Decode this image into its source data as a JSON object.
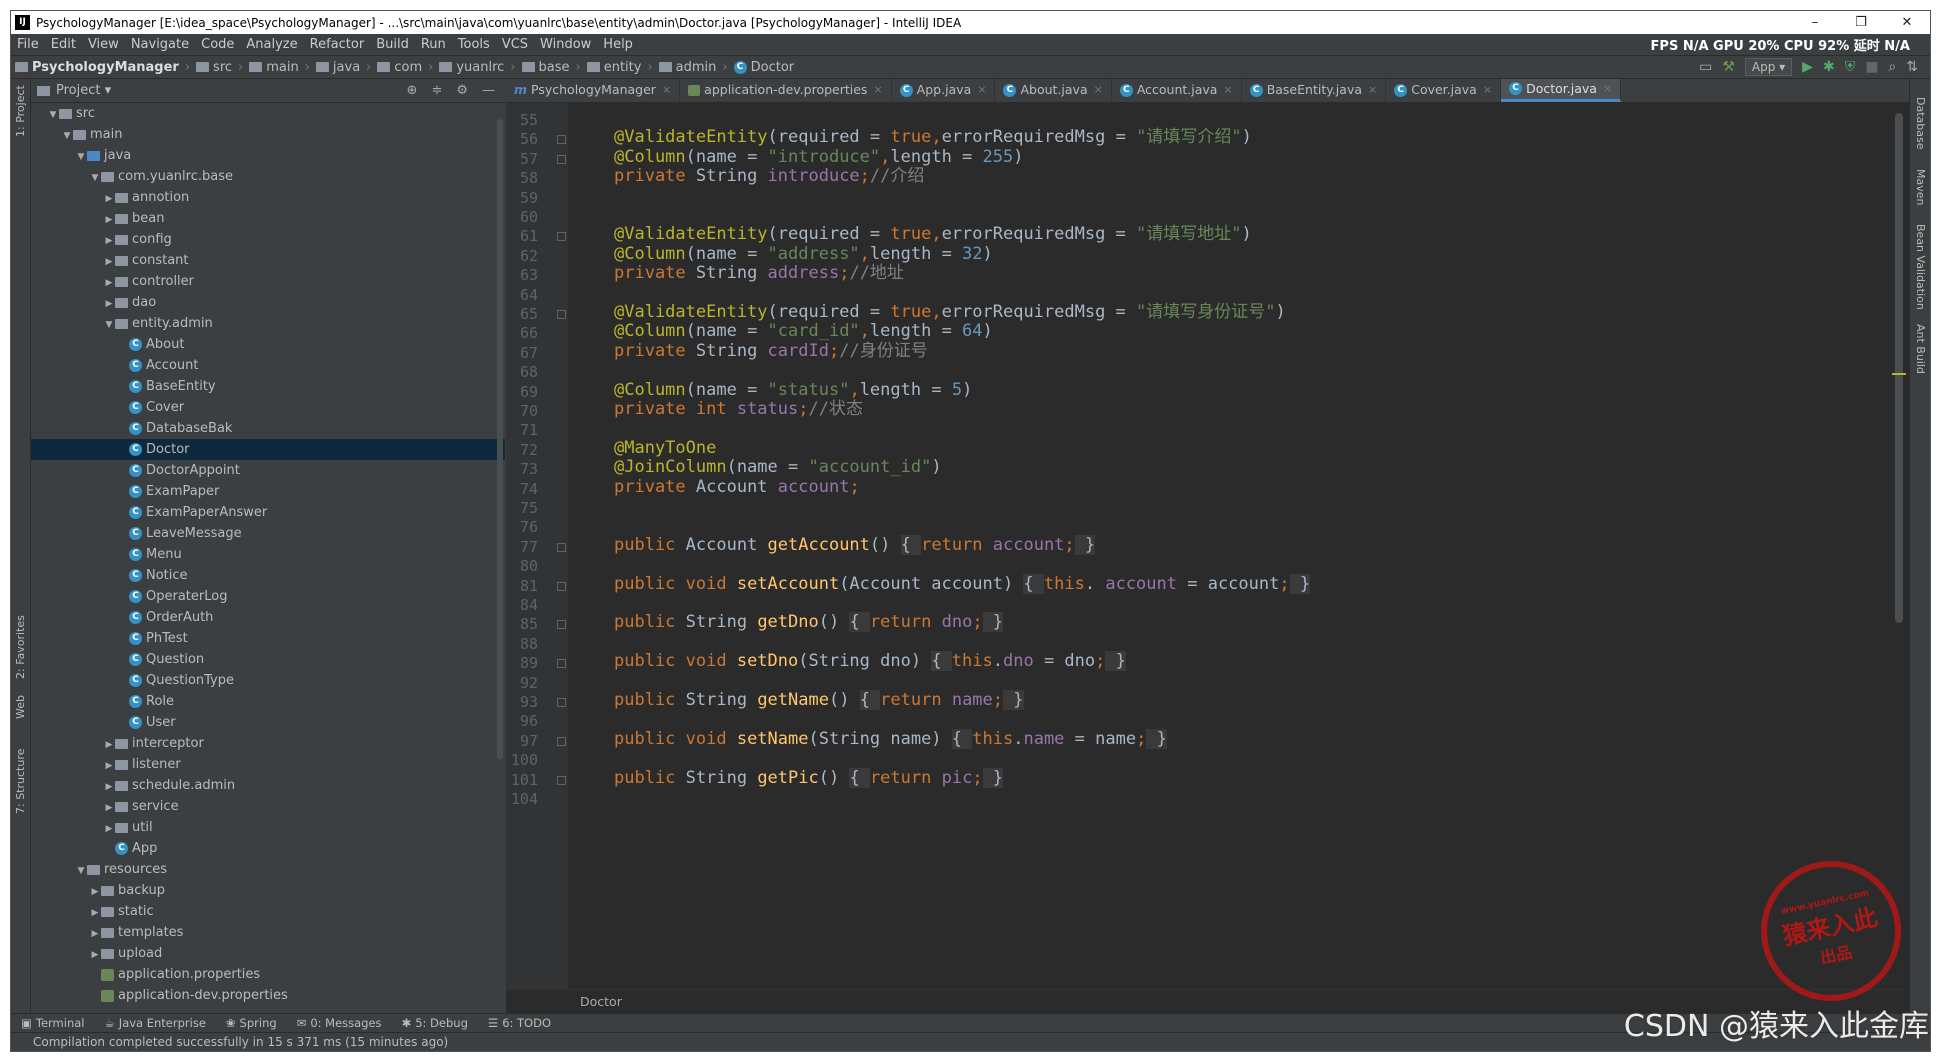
{
  "window": {
    "title": "PsychologyManager [E:\\idea_space\\PsychologyManager] - ...\\src\\main\\java\\com\\yuanlrc\\base\\entity\\admin\\Doctor.java [PsychologyManager] - IntelliJ IDEA",
    "minimize": "–",
    "maximize": "❐",
    "close": "✕"
  },
  "menu": {
    "items": [
      "File",
      "Edit",
      "View",
      "Navigate",
      "Code",
      "Analyze",
      "Refactor",
      "Build",
      "Run",
      "Tools",
      "VCS",
      "Window",
      "Help"
    ],
    "perf": "FPS N/A GPU 20% CPU 92% 延时 N/A"
  },
  "nav": {
    "crumbs": [
      "PsychologyManager",
      "src",
      "main",
      "java",
      "com",
      "yuanlrc",
      "base",
      "entity",
      "admin",
      "Doctor"
    ],
    "run_config": "App ▾"
  },
  "sidebars": {
    "left": [
      "1: Project",
      "2: Favorites",
      "Web",
      "7: Structure"
    ],
    "right": [
      "Database",
      "Maven",
      "Bean Validation",
      "Ant Build"
    ]
  },
  "project": {
    "header": "Project ▾",
    "tree": [
      {
        "label": "src",
        "depth": 1,
        "arrow": "▼",
        "icon": "folder"
      },
      {
        "label": "main",
        "depth": 2,
        "arrow": "▼",
        "icon": "folder"
      },
      {
        "label": "java",
        "depth": 3,
        "arrow": "▼",
        "icon": "src"
      },
      {
        "label": "com.yuanlrc.base",
        "depth": 4,
        "arrow": "▼",
        "icon": "pkg"
      },
      {
        "label": "annotion",
        "depth": 5,
        "arrow": "▶",
        "icon": "pkg"
      },
      {
        "label": "bean",
        "depth": 5,
        "arrow": "▶",
        "icon": "pkg"
      },
      {
        "label": "config",
        "depth": 5,
        "arrow": "▶",
        "icon": "pkg"
      },
      {
        "label": "constant",
        "depth": 5,
        "arrow": "▶",
        "icon": "pkg"
      },
      {
        "label": "controller",
        "depth": 5,
        "arrow": "▶",
        "icon": "pkg"
      },
      {
        "label": "dao",
        "depth": 5,
        "arrow": "▶",
        "icon": "pkg"
      },
      {
        "label": "entity.admin",
        "depth": 5,
        "arrow": "▼",
        "icon": "pkg"
      },
      {
        "label": "About",
        "depth": 6,
        "arrow": "",
        "icon": "class"
      },
      {
        "label": "Account",
        "depth": 6,
        "arrow": "",
        "icon": "class"
      },
      {
        "label": "BaseEntity",
        "depth": 6,
        "arrow": "",
        "icon": "class"
      },
      {
        "label": "Cover",
        "depth": 6,
        "arrow": "",
        "icon": "class"
      },
      {
        "label": "DatabaseBak",
        "depth": 6,
        "arrow": "",
        "icon": "class"
      },
      {
        "label": "Doctor",
        "depth": 6,
        "arrow": "",
        "icon": "class",
        "selected": true
      },
      {
        "label": "DoctorAppoint",
        "depth": 6,
        "arrow": "",
        "icon": "class"
      },
      {
        "label": "ExamPaper",
        "depth": 6,
        "arrow": "",
        "icon": "class"
      },
      {
        "label": "ExamPaperAnswer",
        "depth": 6,
        "arrow": "",
        "icon": "class"
      },
      {
        "label": "LeaveMessage",
        "depth": 6,
        "arrow": "",
        "icon": "class"
      },
      {
        "label": "Menu",
        "depth": 6,
        "arrow": "",
        "icon": "class"
      },
      {
        "label": "Notice",
        "depth": 6,
        "arrow": "",
        "icon": "class"
      },
      {
        "label": "OperaterLog",
        "depth": 6,
        "arrow": "",
        "icon": "class"
      },
      {
        "label": "OrderAuth",
        "depth": 6,
        "arrow": "",
        "icon": "class"
      },
      {
        "label": "PhTest",
        "depth": 6,
        "arrow": "",
        "icon": "class"
      },
      {
        "label": "Question",
        "depth": 6,
        "arrow": "",
        "icon": "class"
      },
      {
        "label": "QuestionType",
        "depth": 6,
        "arrow": "",
        "icon": "class"
      },
      {
        "label": "Role",
        "depth": 6,
        "arrow": "",
        "icon": "class"
      },
      {
        "label": "User",
        "depth": 6,
        "arrow": "",
        "icon": "class"
      },
      {
        "label": "interceptor",
        "depth": 5,
        "arrow": "▶",
        "icon": "pkg"
      },
      {
        "label": "listener",
        "depth": 5,
        "arrow": "▶",
        "icon": "pkg"
      },
      {
        "label": "schedule.admin",
        "depth": 5,
        "arrow": "▶",
        "icon": "pkg"
      },
      {
        "label": "service",
        "depth": 5,
        "arrow": "▶",
        "icon": "pkg"
      },
      {
        "label": "util",
        "depth": 5,
        "arrow": "▶",
        "icon": "pkg"
      },
      {
        "label": "App",
        "depth": 5,
        "arrow": "",
        "icon": "class"
      },
      {
        "label": "resources",
        "depth": 3,
        "arrow": "▼",
        "icon": "folder"
      },
      {
        "label": "backup",
        "depth": 4,
        "arrow": "▶",
        "icon": "folder"
      },
      {
        "label": "static",
        "depth": 4,
        "arrow": "▶",
        "icon": "folder"
      },
      {
        "label": "templates",
        "depth": 4,
        "arrow": "▶",
        "icon": "folder"
      },
      {
        "label": "upload",
        "depth": 4,
        "arrow": "▶",
        "icon": "folder"
      },
      {
        "label": "application.properties",
        "depth": 4,
        "arrow": "",
        "icon": "props"
      },
      {
        "label": "application-dev.properties",
        "depth": 4,
        "arrow": "",
        "icon": "props"
      }
    ]
  },
  "tabs": [
    {
      "label": "PsychologyManager",
      "active": false
    },
    {
      "label": "application-dev.properties",
      "active": false
    },
    {
      "label": "App.java",
      "active": false
    },
    {
      "label": "About.java",
      "active": false
    },
    {
      "label": "Account.java",
      "active": false
    },
    {
      "label": "BaseEntity.java",
      "active": false
    },
    {
      "label": "Cover.java",
      "active": false
    },
    {
      "label": "Doctor.java",
      "active": true
    }
  ],
  "editor": {
    "lines": [
      {
        "n": "55",
        "fold": false,
        "tokens": []
      },
      {
        "n": "56",
        "fold": true,
        "tokens": [
          [
            "an",
            "@ValidateEntity"
          ],
          [
            "",
            "("
          ],
          [
            "",
            "required"
          ],
          [
            "",
            " = "
          ],
          [
            "kw",
            "true"
          ],
          [
            "kw",
            ","
          ],
          [
            "",
            "errorRequiredMsg"
          ],
          [
            "",
            " = "
          ],
          [
            "st",
            "\"请填写介绍\""
          ],
          [
            "",
            ")"
          ]
        ]
      },
      {
        "n": "57",
        "fold": true,
        "tokens": [
          [
            "an",
            "@Column"
          ],
          [
            "",
            "(name = "
          ],
          [
            "st",
            "\"introduce\""
          ],
          [
            "kw",
            ","
          ],
          [
            "",
            "length = "
          ],
          [
            "nm",
            "255"
          ],
          [
            "",
            ")"
          ]
        ]
      },
      {
        "n": "58",
        "fold": false,
        "tokens": [
          [
            "kw",
            "private "
          ],
          [
            "",
            "String "
          ],
          [
            "fd",
            "introduce"
          ],
          [
            "kw",
            ";"
          ],
          [
            "cm",
            "//介绍"
          ]
        ]
      },
      {
        "n": "59",
        "fold": false,
        "tokens": []
      },
      {
        "n": "60",
        "fold": false,
        "tokens": []
      },
      {
        "n": "61",
        "fold": true,
        "tokens": [
          [
            "an",
            "@ValidateEntity"
          ],
          [
            "",
            "(required = "
          ],
          [
            "kw",
            "true"
          ],
          [
            "kw",
            ","
          ],
          [
            "",
            "errorRequiredMsg = "
          ],
          [
            "st",
            "\"请填写地址\""
          ],
          [
            "",
            ")"
          ]
        ]
      },
      {
        "n": "62",
        "fold": false,
        "tokens": [
          [
            "an",
            "@Column"
          ],
          [
            "",
            "(name = "
          ],
          [
            "st",
            "\"address\""
          ],
          [
            "kw",
            ","
          ],
          [
            "",
            "length = "
          ],
          [
            "nm",
            "32"
          ],
          [
            "",
            ")"
          ]
        ]
      },
      {
        "n": "63",
        "fold": false,
        "tokens": [
          [
            "kw",
            "private "
          ],
          [
            "",
            "String "
          ],
          [
            "fd",
            "address"
          ],
          [
            "kw",
            ";"
          ],
          [
            "cm",
            "//地址"
          ]
        ]
      },
      {
        "n": "64",
        "fold": false,
        "tokens": []
      },
      {
        "n": "65",
        "fold": true,
        "tokens": [
          [
            "an",
            "@ValidateEntity"
          ],
          [
            "",
            "(required = "
          ],
          [
            "kw",
            "true"
          ],
          [
            "kw",
            ","
          ],
          [
            "",
            "errorRequiredMsg = "
          ],
          [
            "st",
            "\"请填写身份证号\""
          ],
          [
            "",
            ")"
          ]
        ]
      },
      {
        "n": "66",
        "fold": false,
        "tokens": [
          [
            "an",
            "@Column"
          ],
          [
            "",
            "(name = "
          ],
          [
            "st",
            "\"card_id\""
          ],
          [
            "kw",
            ","
          ],
          [
            "",
            "length = "
          ],
          [
            "nm",
            "64"
          ],
          [
            "",
            ")"
          ]
        ]
      },
      {
        "n": "67",
        "fold": false,
        "tokens": [
          [
            "kw",
            "private "
          ],
          [
            "",
            "String "
          ],
          [
            "fd",
            "cardId"
          ],
          [
            "kw",
            ";"
          ],
          [
            "cm",
            "//身份证号"
          ]
        ]
      },
      {
        "n": "68",
        "fold": false,
        "tokens": []
      },
      {
        "n": "69",
        "fold": false,
        "tokens": [
          [
            "an",
            "@Column"
          ],
          [
            "",
            "(name = "
          ],
          [
            "st",
            "\"status\""
          ],
          [
            "kw",
            ","
          ],
          [
            "",
            "length = "
          ],
          [
            "nm",
            "5"
          ],
          [
            "",
            ")"
          ]
        ]
      },
      {
        "n": "70",
        "fold": false,
        "tokens": [
          [
            "kw",
            "private int "
          ],
          [
            "fd",
            "status"
          ],
          [
            "kw",
            ";"
          ],
          [
            "cm",
            "//状态"
          ]
        ]
      },
      {
        "n": "71",
        "fold": false,
        "tokens": []
      },
      {
        "n": "72",
        "fold": false,
        "tokens": [
          [
            "an",
            "@ManyToOne"
          ]
        ]
      },
      {
        "n": "73",
        "fold": false,
        "tokens": [
          [
            "an",
            "@JoinColumn"
          ],
          [
            "",
            "(name = "
          ],
          [
            "st",
            "\"account_id\""
          ],
          [
            "",
            ")"
          ]
        ]
      },
      {
        "n": "74",
        "fold": false,
        "tokens": [
          [
            "kw",
            "private "
          ],
          [
            "",
            "Account "
          ],
          [
            "fd",
            "account"
          ],
          [
            "kw",
            ";"
          ]
        ]
      },
      {
        "n": "75",
        "fold": false,
        "tokens": []
      },
      {
        "n": "76",
        "fold": false,
        "tokens": []
      },
      {
        "n": "77",
        "fold": true,
        "tokens": [
          [
            "kw",
            "public "
          ],
          [
            "",
            "Account "
          ],
          [
            "fn",
            "getAccount"
          ],
          [
            "",
            "() "
          ],
          [
            "br",
            "{ "
          ],
          [
            "kw",
            "return "
          ],
          [
            "fd",
            "account"
          ],
          [
            "kw",
            ";"
          ],
          [
            "br",
            " }"
          ]
        ]
      },
      {
        "n": "80",
        "fold": false,
        "tokens": []
      },
      {
        "n": "81",
        "fold": true,
        "tokens": [
          [
            "kw",
            "public void "
          ],
          [
            "fn",
            "setAccount"
          ],
          [
            "",
            "(Account account) "
          ],
          [
            "br",
            "{ "
          ],
          [
            "kw",
            "this"
          ],
          [
            "",
            ". "
          ],
          [
            "fd",
            "account"
          ],
          [
            "",
            " = account"
          ],
          [
            "kw",
            ";"
          ],
          [
            "br",
            " }"
          ]
        ]
      },
      {
        "n": "84",
        "fold": false,
        "tokens": []
      },
      {
        "n": "85",
        "fold": true,
        "tokens": [
          [
            "kw",
            "public "
          ],
          [
            "",
            "String "
          ],
          [
            "fn",
            "getDno"
          ],
          [
            "",
            "() "
          ],
          [
            "br",
            "{ "
          ],
          [
            "kw",
            "return "
          ],
          [
            "fd",
            "dno"
          ],
          [
            "kw",
            ";"
          ],
          [
            "br",
            " }"
          ]
        ]
      },
      {
        "n": "88",
        "fold": false,
        "tokens": []
      },
      {
        "n": "89",
        "fold": true,
        "tokens": [
          [
            "kw",
            "public void "
          ],
          [
            "fn",
            "setDno"
          ],
          [
            "",
            "(String dno) "
          ],
          [
            "br",
            "{ "
          ],
          [
            "kw",
            "this"
          ],
          [
            "",
            "."
          ],
          [
            "fd",
            "dno"
          ],
          [
            "",
            " = dno"
          ],
          [
            "kw",
            ";"
          ],
          [
            "br",
            " }"
          ]
        ]
      },
      {
        "n": "92",
        "fold": false,
        "tokens": []
      },
      {
        "n": "93",
        "fold": true,
        "tokens": [
          [
            "kw",
            "public "
          ],
          [
            "",
            "String "
          ],
          [
            "fn",
            "getName"
          ],
          [
            "",
            "() "
          ],
          [
            "br",
            "{ "
          ],
          [
            "kw",
            "return "
          ],
          [
            "fd",
            "name"
          ],
          [
            "kw",
            ";"
          ],
          [
            "br",
            " }"
          ]
        ]
      },
      {
        "n": "96",
        "fold": false,
        "tokens": []
      },
      {
        "n": "97",
        "fold": true,
        "tokens": [
          [
            "kw",
            "public void "
          ],
          [
            "fn",
            "setName"
          ],
          [
            "",
            "(String name) "
          ],
          [
            "br",
            "{ "
          ],
          [
            "kw",
            "this"
          ],
          [
            "",
            "."
          ],
          [
            "fd",
            "name"
          ],
          [
            "",
            " = name"
          ],
          [
            "kw",
            ";"
          ],
          [
            "br",
            " }"
          ]
        ]
      },
      {
        "n": "100",
        "fold": false,
        "tokens": []
      },
      {
        "n": "101",
        "fold": true,
        "tokens": [
          [
            "kw",
            "public "
          ],
          [
            "",
            "String "
          ],
          [
            "fn",
            "getPic"
          ],
          [
            "",
            "() "
          ],
          [
            "br",
            "{ "
          ],
          [
            "kw",
            "return "
          ],
          [
            "fd",
            "pic"
          ],
          [
            "kw",
            ";"
          ],
          [
            "br",
            " }"
          ]
        ]
      },
      {
        "n": "104",
        "fold": false,
        "tokens": []
      }
    ],
    "bottom_crumb": "Doctor"
  },
  "bottom_tools": [
    "Terminal",
    "Java Enterprise",
    "Spring",
    "0: Messages",
    "5: Debug",
    "6: TODO"
  ],
  "status": "Compilation completed successfully in 15 s 371 ms (15 minutes ago)",
  "watermark": {
    "main": "猿来入此",
    "sub": "出品",
    "url": "www.yuanlrc.com"
  },
  "csdn": "CSDN @猿来入此金库"
}
